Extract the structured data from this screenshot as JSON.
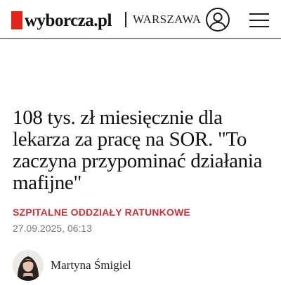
{
  "header": {
    "logo_text": "wyborcza.pl",
    "city": "WARSZAWA",
    "user_icon": "user-account-icon",
    "menu_icon": "hamburger-menu-icon",
    "brand_color": "#e2231a"
  },
  "article": {
    "title": "108 tys. zł miesięcznie dla lekarza za pracę na SOR. \"To zaczyna przypominać działania mafijne\"",
    "section": "SZPITALNE ODDZIAŁY RATUNKOWE",
    "section_color": "#c8343a",
    "date": "27.09.2025, 06:13",
    "author": {
      "name": "Martyna Śmigiel",
      "avatar_icon": "author-avatar"
    }
  }
}
